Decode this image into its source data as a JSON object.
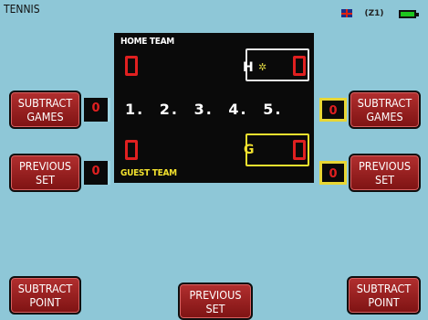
{
  "app": {
    "title": "TENNIS"
  },
  "status": {
    "signal_label": "(Z1)",
    "flag_icon": "uk-flag-icon",
    "battery_icon": "battery-icon"
  },
  "scoreboard": {
    "home_label": "HOME TEAM",
    "guest_label": "GUEST TEAM",
    "home_marker": "H",
    "guest_marker": "G",
    "home_games": "0",
    "home_points": "0",
    "guest_games": "0",
    "guest_points": "0",
    "sets": [
      "1.",
      "2.",
      "3.",
      "4.",
      "5."
    ],
    "serve_indicator": "home"
  },
  "buttons": {
    "subtract_games_left": "SUBTRACT\nGAMES",
    "subtract_games_right": "SUBTRACT\nGAMES",
    "previous_set_left": "PREVIOUS\nSET",
    "previous_set_right": "PREVIOUS\nSET",
    "subtract_point_left": "SUBTRACT\nPOINT",
    "subtract_point_right": "SUBTRACT\nPOINT",
    "previous_set_center": "PREVIOUS\nSET"
  },
  "values": {
    "games_left": "0",
    "games_right": "0",
    "set_left": "0",
    "set_right": "0"
  },
  "colors": {
    "background": "#8ec7d7",
    "button": "#9a2020",
    "digit": "#e02020",
    "guest": "#f2e12e"
  }
}
